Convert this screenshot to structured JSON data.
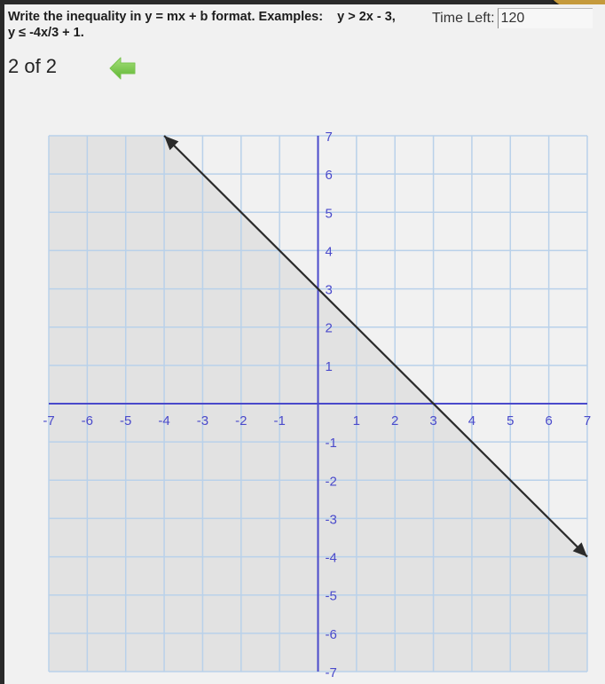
{
  "question": {
    "line1": "Write the inequality in y = mx + b format. Examples:",
    "example1": "y > 2x - 3,",
    "line2": "y ≤ -4x/3 + 1."
  },
  "timer": {
    "label": "Time Left:",
    "value": "120"
  },
  "navigation": {
    "counter": "2 of 2",
    "back_icon": "green-left-arrow-icon"
  },
  "colors": {
    "grid": "#b9d1ea",
    "axis": "#4a4acb",
    "shade": "#e2e2e2",
    "line": "#2b2b2b",
    "background": "#f1f1f1",
    "back_arrow": "#7dcf4a"
  },
  "chart_data": {
    "type": "line",
    "title": "",
    "xlabel": "",
    "ylabel": "",
    "xlim": [
      -7,
      7
    ],
    "ylim": [
      -7,
      7
    ],
    "grid": true,
    "x_ticks": [
      -7,
      -6,
      -5,
      -4,
      -3,
      -2,
      -1,
      1,
      2,
      3,
      4,
      5,
      6,
      7
    ],
    "y_ticks": [
      7,
      6,
      5,
      4,
      3,
      2,
      1,
      -1,
      -2,
      -3,
      -4,
      -5,
      -6,
      -7
    ],
    "boundary_line": {
      "equation": "y = -x + 3",
      "slope": -1,
      "intercept": 3,
      "style": "solid",
      "arrow_start": [
        -4,
        7
      ],
      "arrow_end": [
        7,
        -4
      ],
      "points": [
        [
          0,
          3
        ],
        [
          3,
          0
        ]
      ]
    },
    "shaded_region": "below",
    "inequality": "y ≤ -x + 3"
  }
}
